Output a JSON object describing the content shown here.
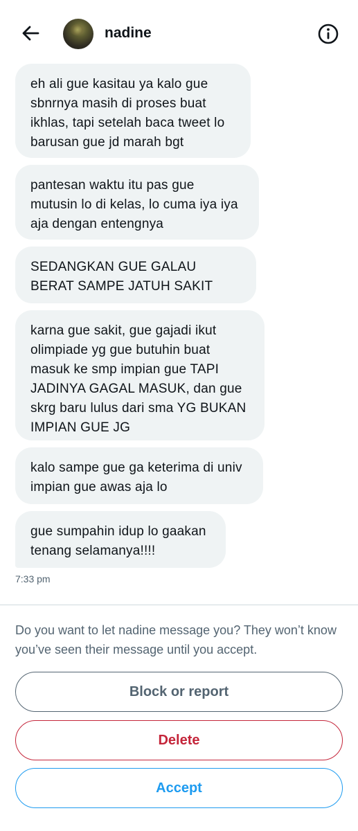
{
  "header": {
    "username": "nadine",
    "back_icon": "arrow-left-icon",
    "info_icon": "info-circle-icon"
  },
  "messages": [
    {
      "text": "eh ali gue kasitau ya kalo gue sbnrnya masih di proses buat ikhlas, tapi setelah baca tweet lo barusan gue jd marah bgt"
    },
    {
      "text": "pantesan waktu itu pas gue mutusin lo di kelas, lo cuma iya iya aja dengan entengnya"
    },
    {
      "text": "SEDANGKAN GUE GALAU BERAT SAMPE JATUH SAKIT"
    },
    {
      "text": "karna gue sakit, gue gajadi ikut olimpiade yg gue butuhin buat masuk ke smp impian gue TAPI JADINYA GAGAL MASUK, dan gue skrg baru lulus dari sma YG BUKAN IMPIAN GUE JG"
    },
    {
      "text": "kalo sampe gue ga keterima di univ impian gue awas aja lo"
    },
    {
      "text": "gue sumpahin idup lo gaakan tenang selamanya!!!!"
    }
  ],
  "timestamp": "7:33 pm",
  "request": {
    "prompt": "Do you want to let nadine message you? They won’t know you’ve seen their message until you accept.",
    "block_label": "Block or report",
    "delete_label": "Delete",
    "accept_label": "Accept"
  },
  "colors": {
    "bubble": "#eff3f4",
    "secondary_text": "#536471",
    "delete": "#c4253a",
    "accept": "#1d9bf0"
  }
}
